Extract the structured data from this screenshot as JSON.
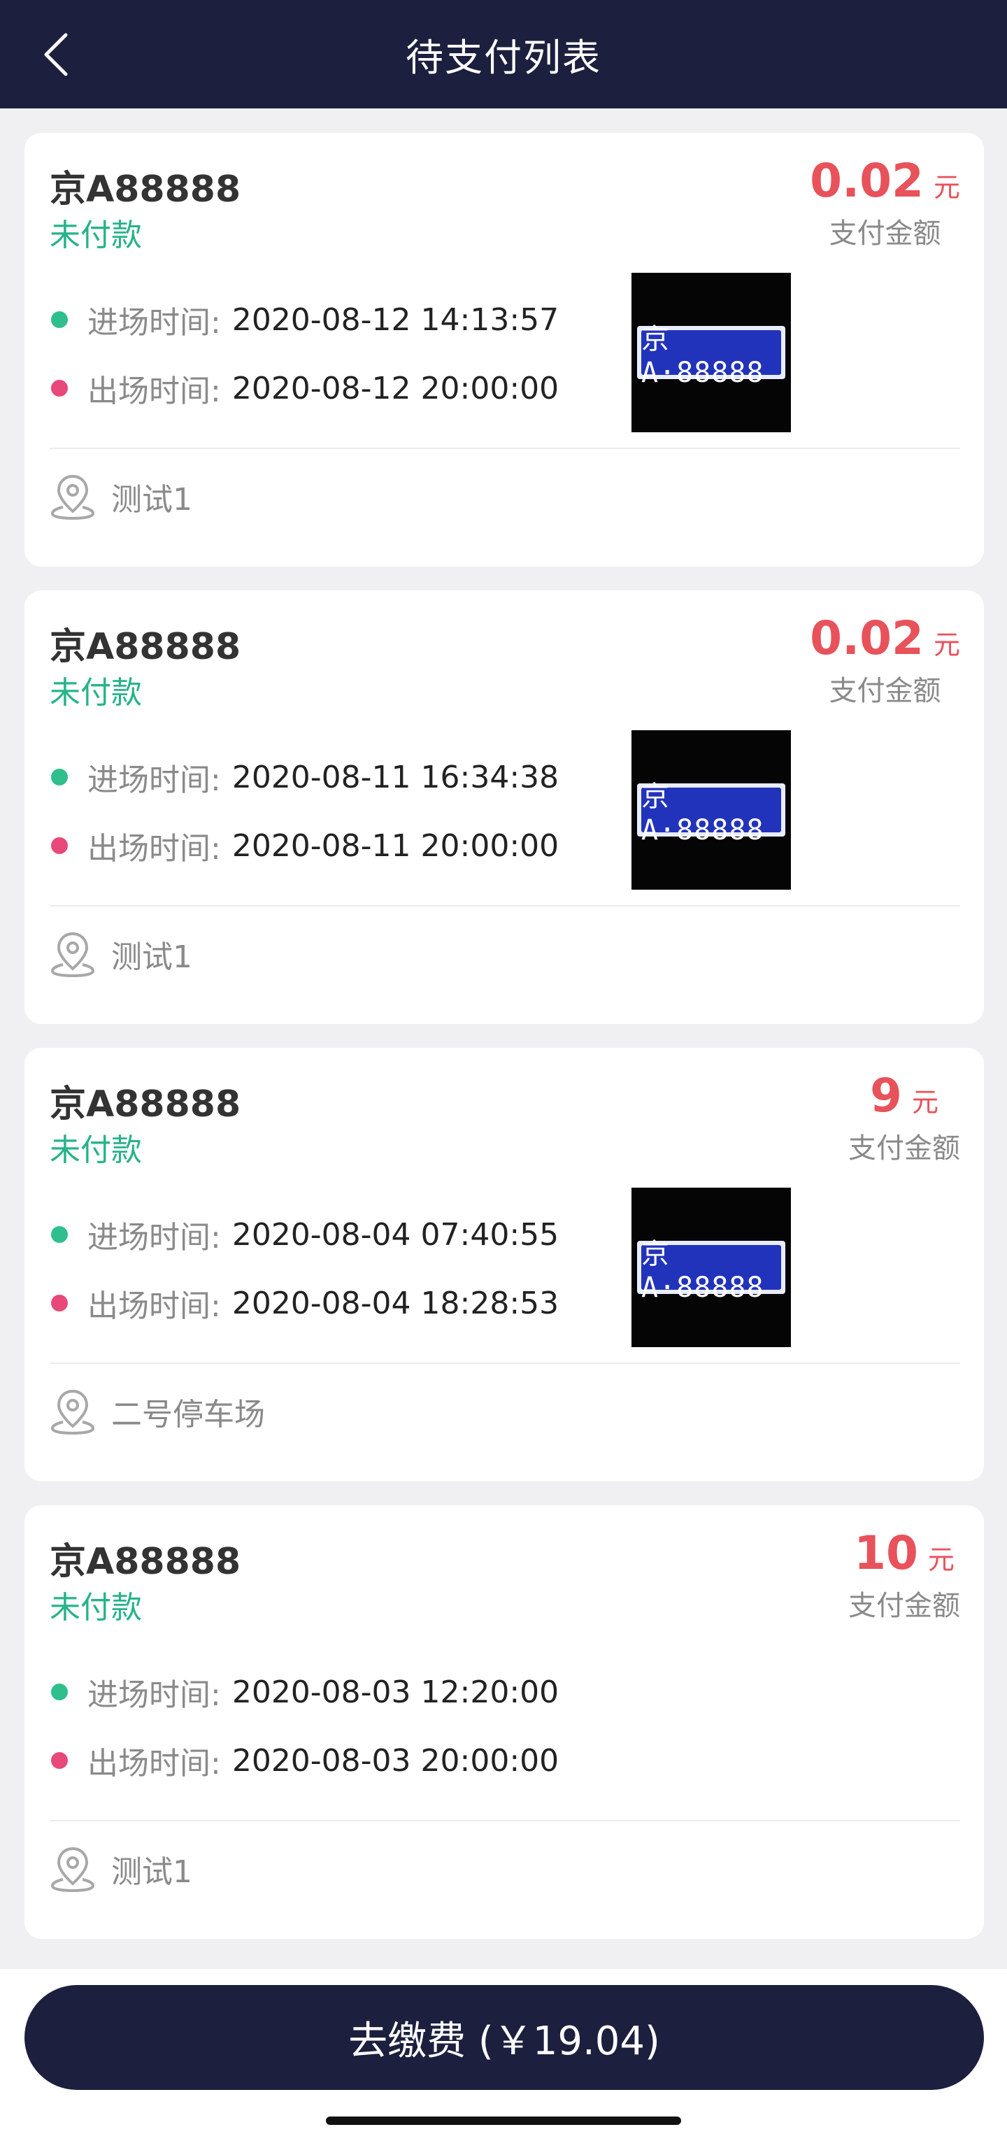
{
  "header": {
    "title": "待支付列表"
  },
  "orders": [
    {
      "plate": "京A88888",
      "status": "未付款",
      "amount": "0.02",
      "unit": "元",
      "amount_label": "支付金额",
      "entry_label": "进场时间:",
      "entry_time": "2020-08-12 14:13:57",
      "exit_label": "出场时间:",
      "exit_time": "2020-08-12 20:00:00",
      "photo_plate": "京A·88888",
      "lot": "测试1"
    },
    {
      "plate": "京A88888",
      "status": "未付款",
      "amount": "0.02",
      "unit": "元",
      "amount_label": "支付金额",
      "entry_label": "进场时间:",
      "entry_time": "2020-08-11 16:34:38",
      "exit_label": "出场时间:",
      "exit_time": "2020-08-11 20:00:00",
      "photo_plate": "京A·88888",
      "lot": "测试1"
    },
    {
      "plate": "京A88888",
      "status": "未付款",
      "amount": "9",
      "unit": "元",
      "amount_label": "支付金额",
      "entry_label": "进场时间:",
      "entry_time": "2020-08-04 07:40:55",
      "exit_label": "出场时间:",
      "exit_time": "2020-08-04 18:28:53",
      "photo_plate": "京A·88888",
      "lot": "二号停车场"
    },
    {
      "plate": "京A88888",
      "status": "未付款",
      "amount": "10",
      "unit": "元",
      "amount_label": "支付金额",
      "entry_label": "进场时间:",
      "entry_time": "2020-08-03 12:20:00",
      "exit_label": "出场时间:",
      "exit_time": "2020-08-03 20:00:00",
      "lot": "测试1"
    }
  ],
  "footer": {
    "pay_button_label": "去缴费 (￥19.04)"
  },
  "colors": {
    "navy": "#1c1f3e",
    "green": "#27b389",
    "red": "#e8525b",
    "pink": "#e8487a"
  }
}
